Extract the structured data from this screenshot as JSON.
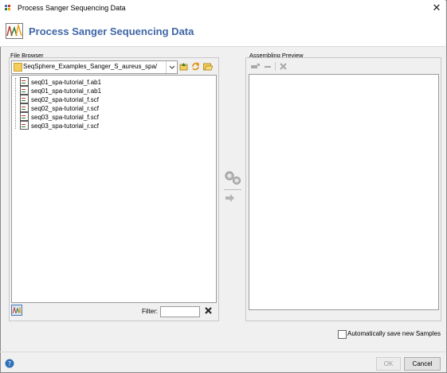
{
  "window": {
    "title": "Process Sanger Sequencing Data",
    "close_glyph": "✕"
  },
  "header": {
    "title": "Process Sanger Sequencing Data"
  },
  "file_browser": {
    "label": "File Browser",
    "directory": "SeqSphere_Examples_Sanger_S_aureus_spa/",
    "files": [
      "seq01_spa-tutorial_f.ab1",
      "seq01_spa-tutorial_r.ab1",
      "seq02_spa-tutorial_f.scf",
      "seq02_spa-tutorial_r.scf",
      "seq03_spa-tutorial_f.scf",
      "seq03_spa-tutorial_r.scf"
    ],
    "filter_label": "Filter:",
    "filter_value": ""
  },
  "assembling_preview": {
    "label": "Assembling Preview"
  },
  "auto_save": {
    "label": "Automatically save new Samples",
    "checked": false
  },
  "buttons": {
    "ok": "OK",
    "cancel": "Cancel"
  },
  "colors": {
    "header_title": "#3f66a7",
    "help_icon": "#2e6fb7",
    "clear_icon": "#222222"
  }
}
